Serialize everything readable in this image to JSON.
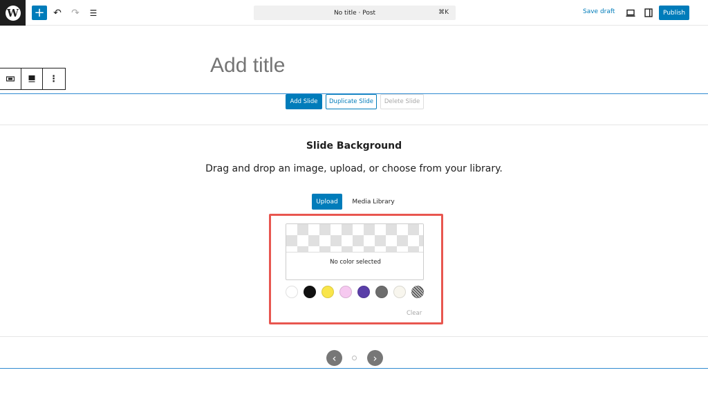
{
  "topbar": {
    "command_text": "No title · Post",
    "command_shortcut": "⌘K",
    "save_draft": "Save draft",
    "publish": "Publish",
    "add_glyph": "+",
    "undo_glyph": "↶",
    "redo_glyph": "↷",
    "listview_glyph": "☰",
    "logo_glyph": "W"
  },
  "editor": {
    "title_placeholder": "Add title"
  },
  "block_toolbar": {
    "icons": [
      "slider-block-icon",
      "slide-block-icon",
      "more-options-icon"
    ],
    "more_glyph": "⋮"
  },
  "slide_controls": {
    "add": "Add Slide",
    "duplicate": "Duplicate Slide",
    "delete": "Delete Slide"
  },
  "background": {
    "heading": "Slide Background",
    "description": "Drag and drop an image, upload, or choose from your library.",
    "upload": "Upload",
    "media_library": "Media Library",
    "no_color": "No color selected",
    "clear": "Clear",
    "swatches": [
      {
        "name": "white",
        "color": "#ffffff"
      },
      {
        "name": "black",
        "color": "#111111"
      },
      {
        "name": "yellow",
        "color": "#f9e54a"
      },
      {
        "name": "pink",
        "color": "#f6c9f0"
      },
      {
        "name": "purple",
        "color": "#5a3ea8"
      },
      {
        "name": "gray",
        "color": "#6d6d6d"
      },
      {
        "name": "off-white",
        "color": "#f8f6ee"
      },
      {
        "name": "pattern",
        "color": "#8a8a8a"
      }
    ]
  },
  "slide_nav": {
    "prev_glyph": "‹",
    "next_glyph": "›"
  },
  "colors": {
    "accent": "#007cba",
    "highlight": "#e8564f"
  }
}
